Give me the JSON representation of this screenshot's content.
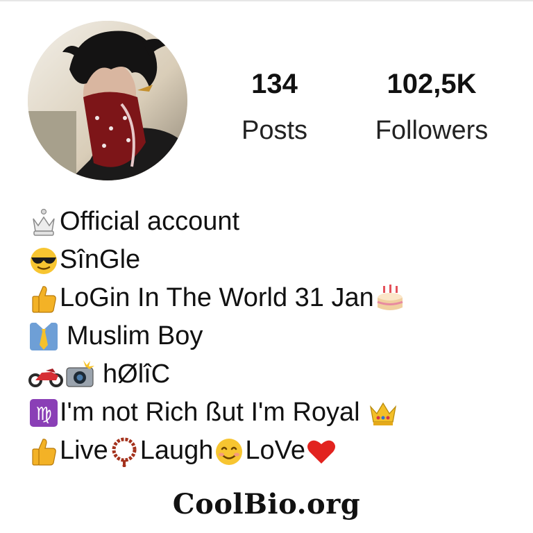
{
  "profile": {
    "posts": {
      "value": "134",
      "label": "Posts"
    },
    "followers": {
      "value": "102,5K",
      "label": "Followers"
    }
  },
  "bio": {
    "lines": [
      {
        "lead_icon": "chess-queen-icon",
        "text": "Official account"
      },
      {
        "lead_icon": "sunglasses-face-icon",
        "text": "SînGle"
      },
      {
        "lead_icon": "thumbs-up-icon",
        "text": "LoGin In The World 31 Jan",
        "trail_icon": "birthday-cake-icon"
      },
      {
        "lead_icon": "necktie-icon",
        "text": "Muslim Boy"
      },
      {
        "lead_icon": "motorcycle-icon",
        "second_icon": "camera-flash-icon",
        "text": "hØlîC"
      },
      {
        "lead_icon": "virgo-icon",
        "text": "I'm not Rich ßut I'm Royal",
        "trail_icon": "crown-icon"
      },
      {
        "lead_icon": "thumbs-up-icon",
        "segments": [
          "Live",
          "Laugh",
          "LoVe"
        ],
        "segment_icons": [
          "prayer-beads-icon",
          "smiling-face-icon",
          "red-heart-icon"
        ]
      }
    ]
  },
  "watermark": "CoolBio.org"
}
